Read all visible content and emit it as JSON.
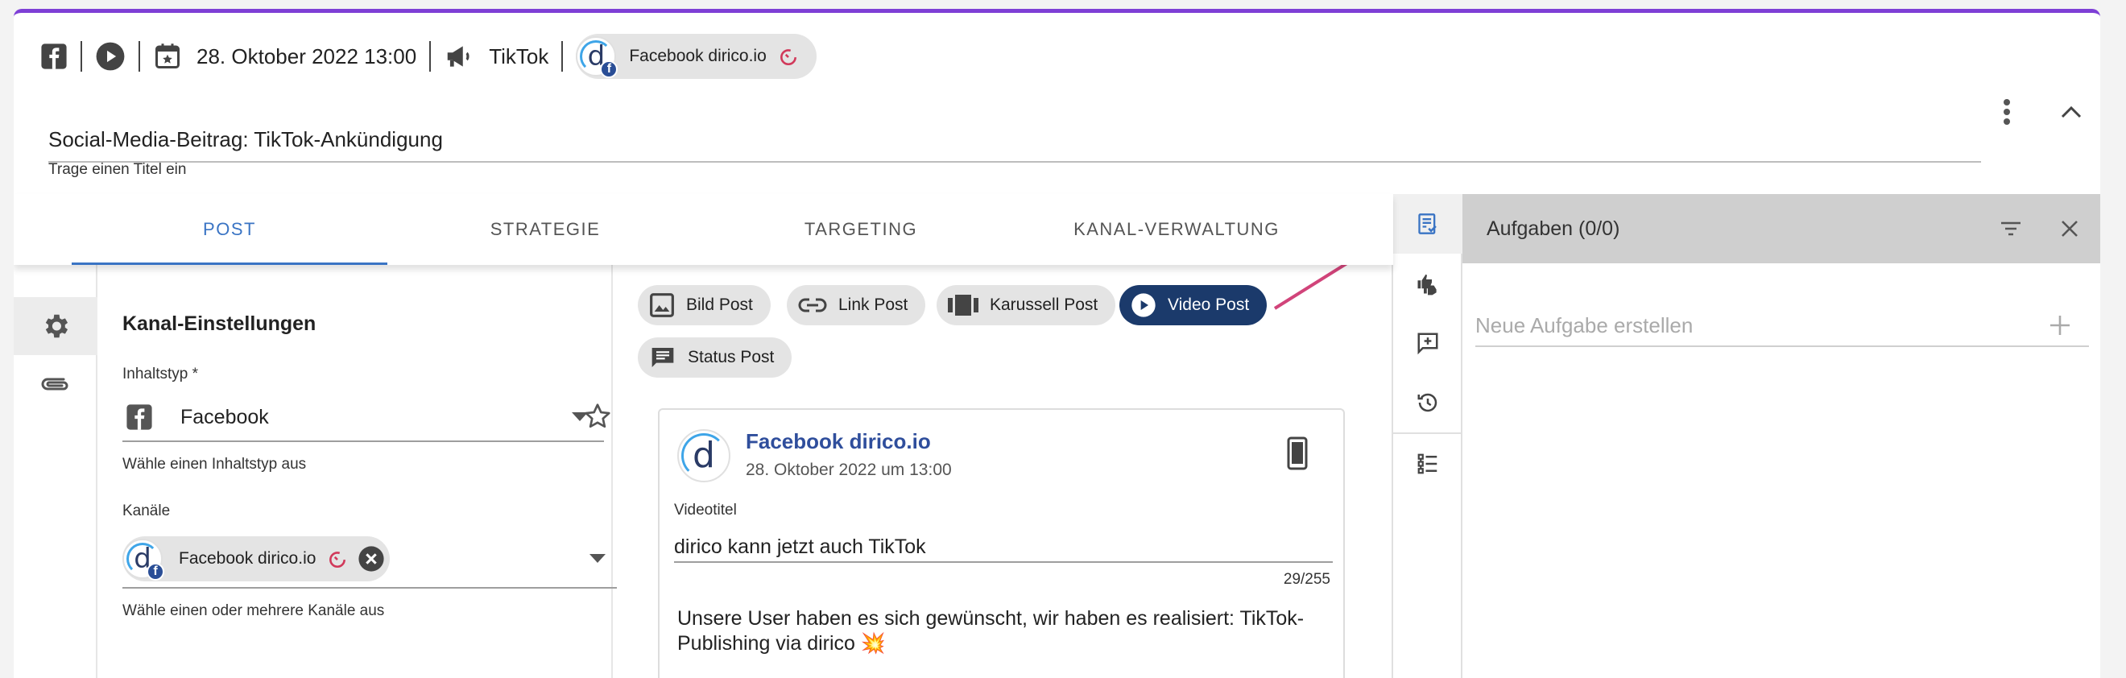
{
  "header": {
    "date": "28. Oktober 2022 13:00",
    "channel_type": "TikTok",
    "account_chip": "Facebook dirico.io"
  },
  "title_field": {
    "value": "Social-Media-Beitrag: TikTok-Ankündigung",
    "helper": "Trage einen Titel ein"
  },
  "tabs": [
    {
      "label": "POST"
    },
    {
      "label": "STRATEGIE"
    },
    {
      "label": "TARGETING"
    },
    {
      "label": "KANAL-VERWALTUNG"
    }
  ],
  "settings": {
    "title": "Kanal-Einstellungen",
    "content_type_label": "Inhaltstyp *",
    "content_type_value": "Facebook",
    "content_type_helper": "Wähle einen Inhaltstyp aus",
    "channels_label": "Kanäle",
    "channel_chip": "Facebook dirico.io",
    "channels_helper": "Wähle einen oder mehrere Kanäle aus"
  },
  "post_types": [
    {
      "label": "Bild Post",
      "icon": "image-icon"
    },
    {
      "label": "Link Post",
      "icon": "link-icon"
    },
    {
      "label": "Karussell Post",
      "icon": "carousel-icon"
    },
    {
      "label": "Video Post",
      "icon": "play-icon",
      "selected": true
    },
    {
      "label": "Status Post",
      "icon": "message-icon"
    }
  ],
  "preview": {
    "page_name": "Facebook dirico.io",
    "date": "28. Oktober 2022 um 13:00",
    "video_title_label": "Videotitel",
    "video_title_value": "dirico kann jetzt auch TikTok",
    "counter": "29/255",
    "body": "Unsere User haben es sich gewünscht, wir haben es realisiert: TikTok-Publishing via dirico 💥"
  },
  "tasks": {
    "title": "Aufgaben (0/0)",
    "new_task_placeholder": "Neue Aufgabe erstellen"
  },
  "colors": {
    "accent_top": "#7e3fd6",
    "active_tab": "#3a74c4",
    "selected_chip": "#1b3a6b",
    "arrow": "#d1447a",
    "fb_blue": "#2a4e96"
  }
}
